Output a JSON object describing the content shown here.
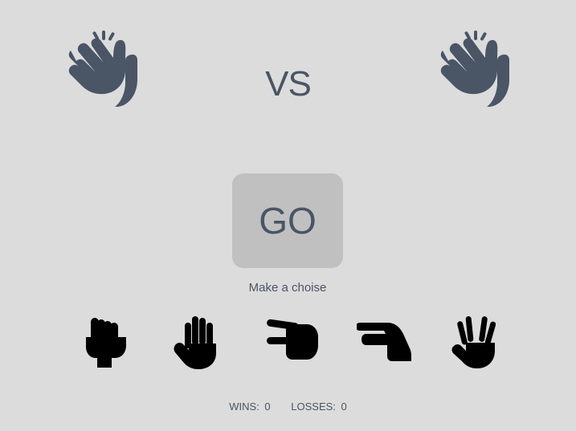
{
  "players": {
    "left_icon": "waving-hands-icon",
    "right_icon": "waving-hands-icon",
    "vs_label": "VS"
  },
  "go_button": {
    "label": "GO"
  },
  "status_text": "Make a choise",
  "choices": [
    {
      "icon": "rock-fist-icon"
    },
    {
      "icon": "paper-hand-icon"
    },
    {
      "icon": "scissors-hand-icon"
    },
    {
      "icon": "lizard-hand-icon"
    },
    {
      "icon": "spock-hand-icon"
    }
  ],
  "score": {
    "wins_label": "WINS:",
    "wins": "0",
    "losses_label": "LOSSES:",
    "losses": "0"
  },
  "colors": {
    "background": "#dcdcdc",
    "text": "#4a5565",
    "button": "#c0c0c0",
    "choice_icon": "#000000"
  }
}
